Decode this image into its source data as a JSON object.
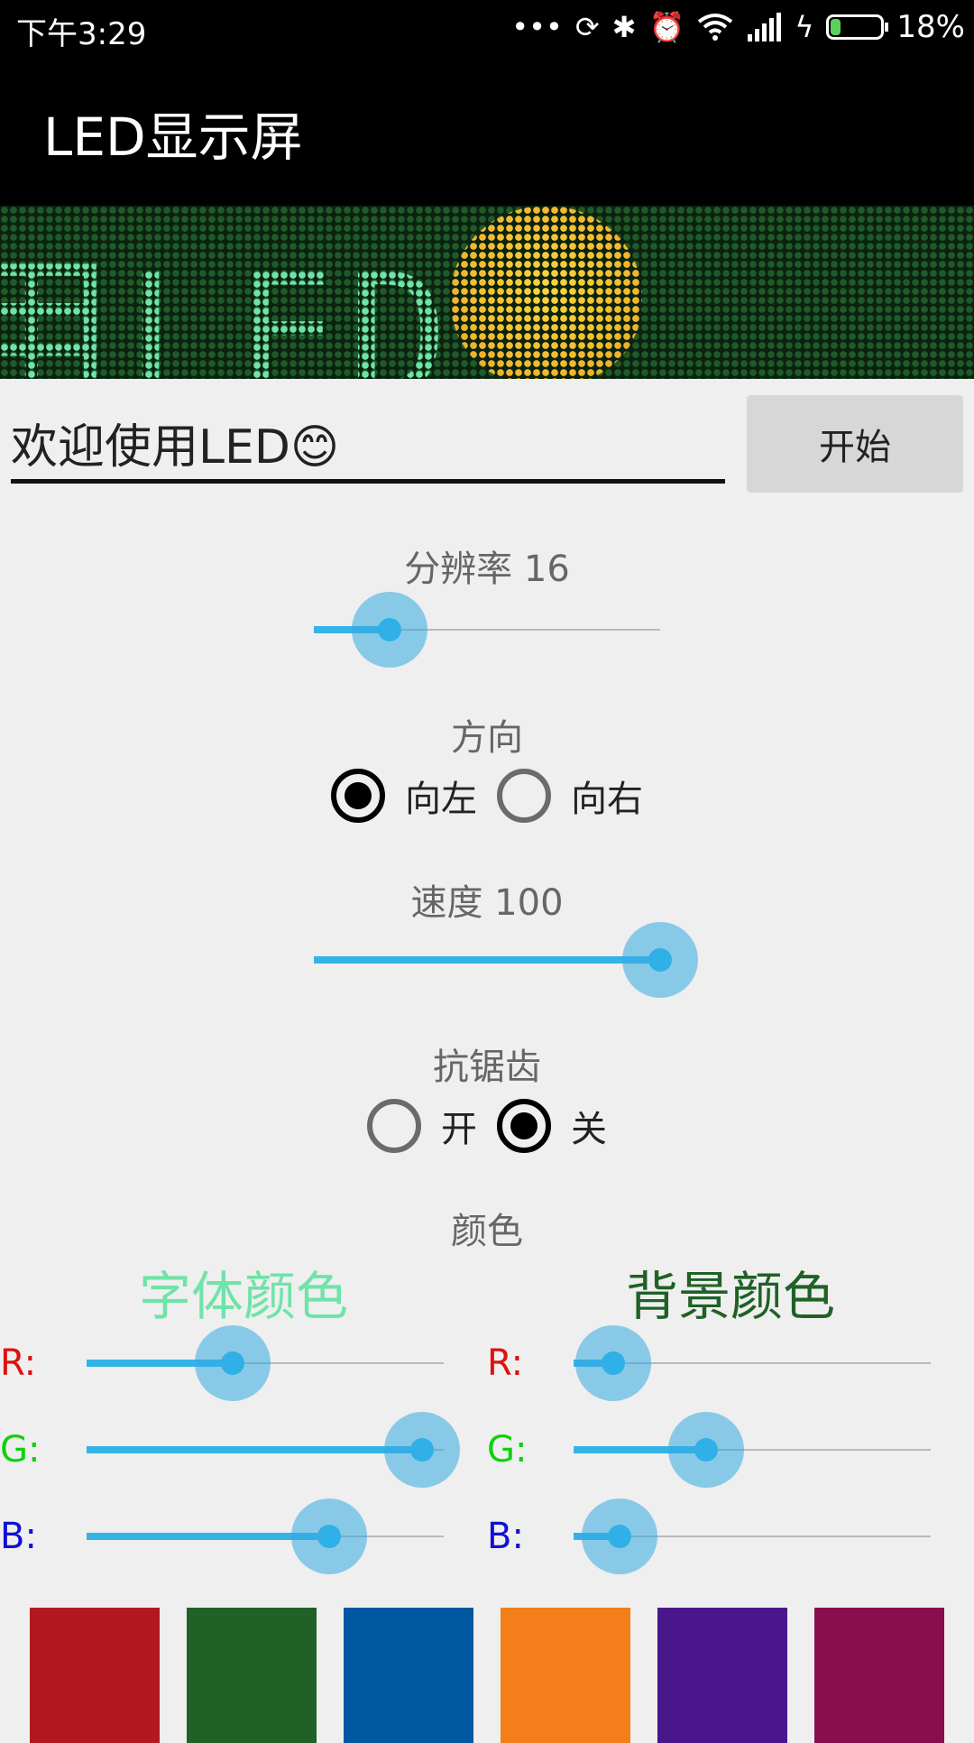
{
  "status_bar": {
    "time": "下午3:29",
    "battery": "18%",
    "battery_level": 0.18
  },
  "app_bar": {
    "title": "LED显示屏"
  },
  "led_display": {
    "scroll_text": "用LED",
    "emoji": "smiling-face"
  },
  "input": {
    "value": "欢迎使用LED😊"
  },
  "start_button": {
    "label": "开始"
  },
  "resolution": {
    "label": "分辨率 16",
    "value": 16,
    "fraction": 0.22
  },
  "direction": {
    "label": "方向",
    "options": [
      {
        "label": "向左",
        "checked": true
      },
      {
        "label": "向右",
        "checked": false
      }
    ]
  },
  "speed": {
    "label": "速度 100",
    "value": 100,
    "fraction": 1.0
  },
  "antialias": {
    "label": "抗锯齿",
    "options": [
      {
        "label": "开",
        "checked": false
      },
      {
        "label": "关",
        "checked": true
      }
    ]
  },
  "color": {
    "label": "颜色",
    "font_color": {
      "title": "字体颜色",
      "color": "#6fe3a8",
      "r": 0.41,
      "g": 0.94,
      "b": 0.68
    },
    "bg_color": {
      "title": "背景颜色",
      "color": "#1f6126",
      "r": 0.11,
      "g": 0.37,
      "b": 0.13
    },
    "r_label": "R:",
    "g_label": "G:",
    "b_label": "B:",
    "r_color": "#e01010",
    "g_color": "#10d010",
    "b_color": "#1010d8"
  },
  "swatches": [
    "#b2191e",
    "#1f6126",
    "#0058a1",
    "#f47e19",
    "#4a168c",
    "#880e4f"
  ],
  "accent": "#34b4e6"
}
